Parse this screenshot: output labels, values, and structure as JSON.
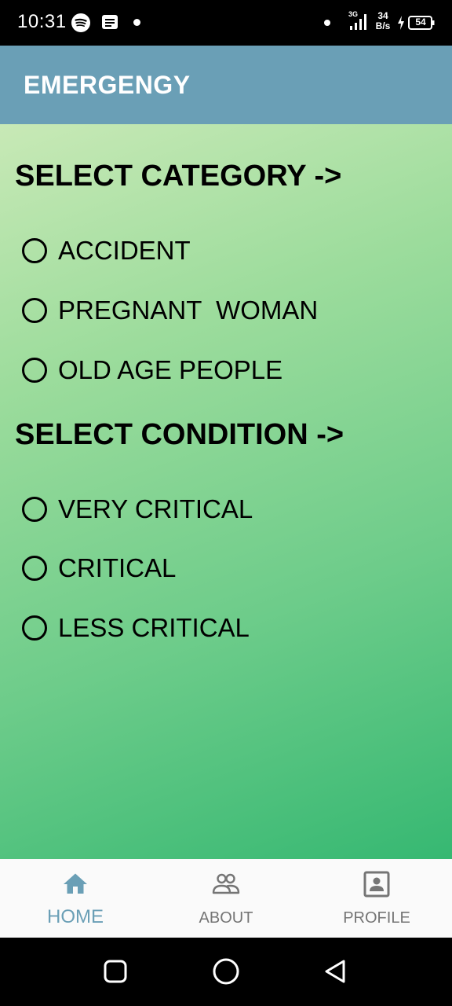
{
  "status_bar": {
    "time": "10:31",
    "network_label": "3G",
    "speed_value": "34",
    "speed_unit": "B/s",
    "battery_level": "54",
    "icons": [
      "spotify-icon",
      "message-icon",
      "notification-dot-icon",
      "signal-icon",
      "charging-icon",
      "battery-icon"
    ]
  },
  "app_bar": {
    "title": "EMERGENGY",
    "color": "#6a9fb6"
  },
  "category": {
    "heading": "SELECT CATEGORY ->",
    "options": [
      {
        "label": "ACCIDENT",
        "selected": false
      },
      {
        "label": "PREGNANT  WOMAN",
        "selected": false
      },
      {
        "label": "OLD AGE PEOPLE",
        "selected": false
      }
    ]
  },
  "condition": {
    "heading": "SELECT CONDITION ->",
    "options": [
      {
        "label": "VERY CRITICAL",
        "selected": false
      },
      {
        "label": "CRITICAL",
        "selected": false
      },
      {
        "label": "LESS CRITICAL",
        "selected": false
      }
    ]
  },
  "bottom_nav": {
    "active_color": "#6a9fb6",
    "inactive_color": "#757575",
    "items": [
      {
        "label": "HOME",
        "icon": "home-icon",
        "active": true
      },
      {
        "label": "ABOUT",
        "icon": "group-icon",
        "active": false
      },
      {
        "label": "PROFILE",
        "icon": "profile-icon",
        "active": false
      }
    ]
  },
  "system_nav": {
    "icons": [
      "recents-icon",
      "home-circle-icon",
      "back-icon"
    ]
  }
}
